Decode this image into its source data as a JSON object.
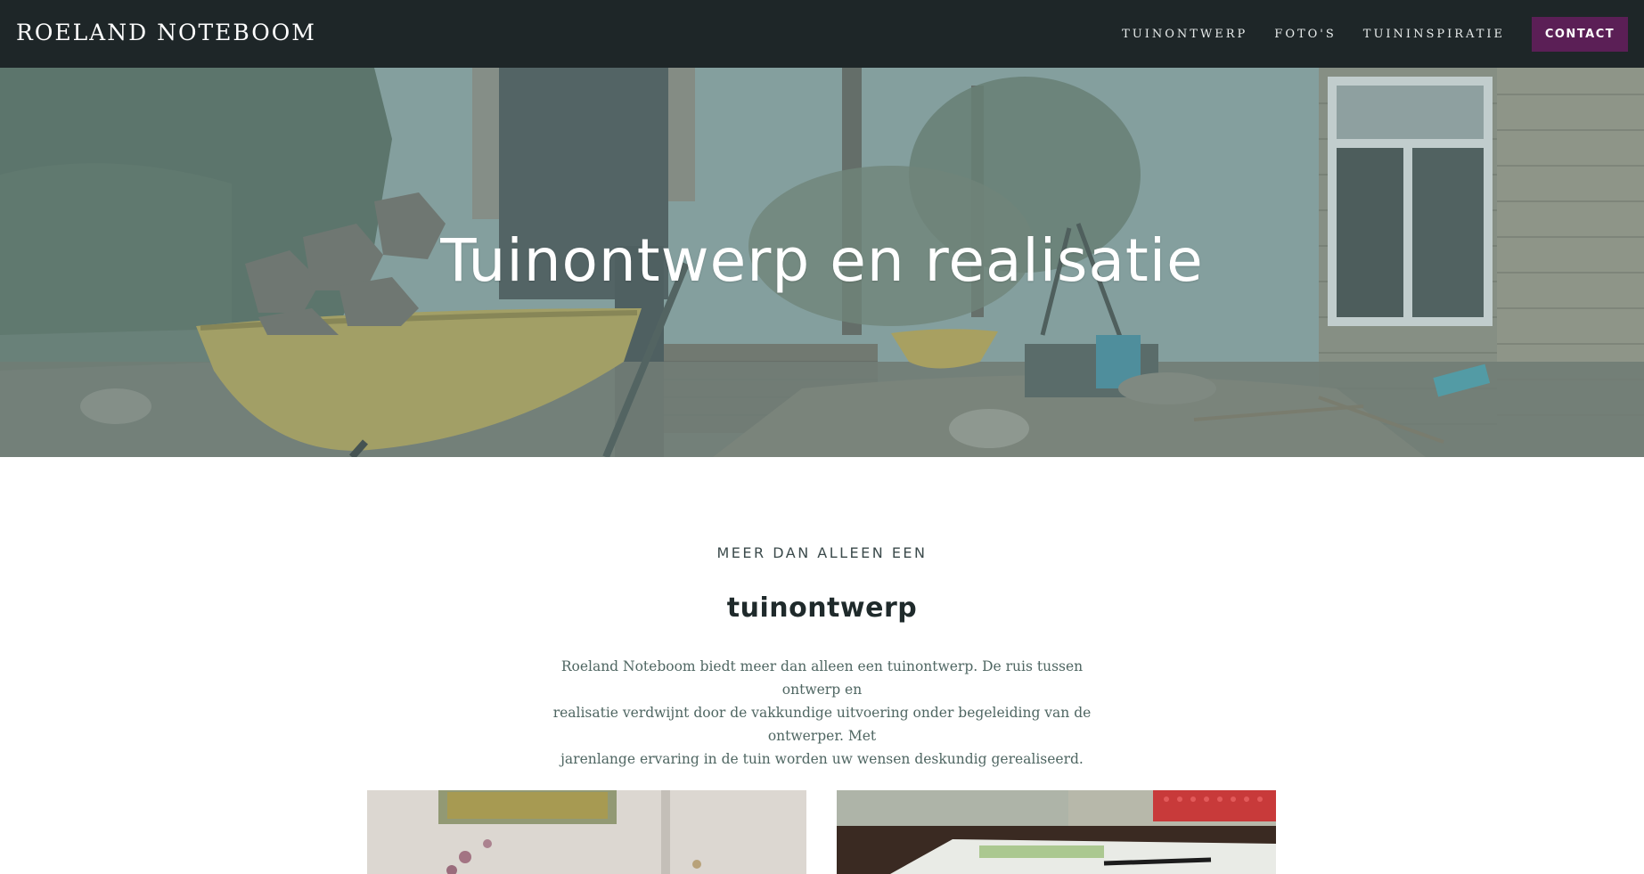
{
  "nav": {
    "logo": "ROELAND NOTEBOOM",
    "links": [
      "TUINONTWERP",
      "FOTO'S",
      "TUININSPIRATIE"
    ],
    "cta": "CONTACT",
    "colors": {
      "bar": "#1e2628",
      "cta": "#5b1f56"
    }
  },
  "hero": {
    "title": "Tuinontwerp en realisatie"
  },
  "intro": {
    "eyebrow": "MEER DAN ALLEEN EEN",
    "title": "tuinontwerp",
    "paragraph_lines": [
      "Roeland Noteboom biedt meer dan alleen een tuinontwerp. De ruis tussen ontwerp en",
      "realisatie verdwijnt door de vakkundige uitvoering onder begeleiding van de ontwerper. Met",
      "jarenlange ervaring in de tuin worden uw wensen deskundig gerealiseerd."
    ]
  }
}
